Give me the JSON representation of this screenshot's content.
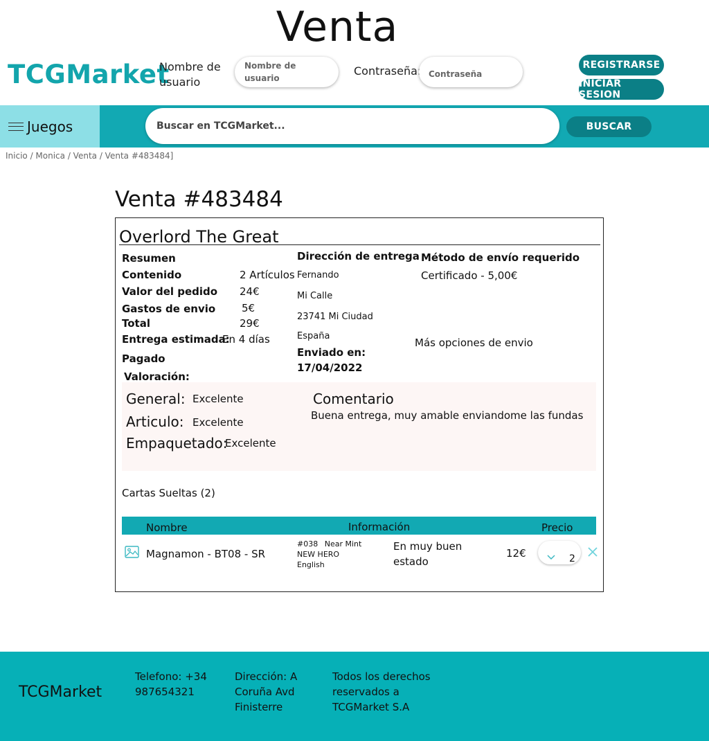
{
  "page": {
    "heading": "Venta"
  },
  "header": {
    "brand": "TCGMarket",
    "username_label_1": "Nombre de",
    "username_label_2": "usuario",
    "username_placeholder_1": "Nombre de",
    "username_placeholder_2": "usuario",
    "password_label": "Contraseña:",
    "password_placeholder": "Contraseña",
    "register_button": "REGISTRARSE",
    "login_button": "INICIAR SESION"
  },
  "nav": {
    "games_menu": "Juegos",
    "search_placeholder": "Buscar en TCGMarket...",
    "search_button": "BUSCAR"
  },
  "breadcrumb": "Inicio / Monica / Venta / Venta #483484]",
  "sale": {
    "title": "Venta #483484",
    "product_name": "Overlord The Great",
    "summary": {
      "heading": "Resumen",
      "content_label": "Contenido",
      "content_value": "2 Artículos",
      "order_value_label": "Valor del pedido",
      "order_value": "24€",
      "shipping_label": "Gastos de envio",
      "shipping_value": "5€",
      "total_label": "Total",
      "total_value": "29€",
      "estimated_label": "Entrega estimada:",
      "estimated_value": "En 4 días",
      "paid": "Pagado",
      "rating_label": "Valoración:"
    },
    "delivery": {
      "heading": "Dirección de entrega",
      "name": "Fernando",
      "street": "Mi Calle",
      "city": "23741 Mi Ciudad",
      "country": "España",
      "sent_label": "Enviado en:",
      "sent_date": "17/04/2022"
    },
    "shipping_method": {
      "heading": "Método de envío requerido",
      "value": "Certificado - 5,00€",
      "more_options": "Más opciones de envio"
    },
    "rating": {
      "general_label": "General:",
      "general_value": "Excelente",
      "article_label": "Articulo:",
      "article_value": "Excelente",
      "packing_label": "Empaquetado:",
      "packing_value": "Excelente",
      "comment_label": "Comentario",
      "comment_text": "Buena entrega, muy amable enviandome las fundas"
    },
    "singles_heading": "Cartas Sueltas (2)",
    "table": {
      "headers": [
        "Nombre",
        "Información",
        "Precio"
      ],
      "rows": [
        {
          "name": "Magnamon - BT08 - SR",
          "number": "#038",
          "condition": "Near Mint",
          "set": "NEW HERO",
          "language": "English",
          "status_1": "En muy buen",
          "status_2": "estado",
          "price": "12€",
          "quantity": "2"
        }
      ]
    }
  },
  "footer": {
    "brand": "TCGMarket",
    "phone_1": "Telefono: +34",
    "phone_2": "987654321",
    "address_1": "Dirección: A",
    "address_2": "Coruña Avd",
    "address_3": "Finisterre",
    "rights_1": "Todos los derechos",
    "rights_2": "reservados a",
    "rights_3": "TCGMarket S.A"
  },
  "colors": {
    "brand": "#13a5ac",
    "navbar": "#12a9b3",
    "games_menu": "#8ddfe6",
    "button": "#0b7f86",
    "footer": "#06b0b7",
    "rating_panel": "#fdf6f5"
  },
  "icons": [
    "menu-icon",
    "image-placeholder-icon",
    "chevron-down-icon",
    "close-icon"
  ]
}
